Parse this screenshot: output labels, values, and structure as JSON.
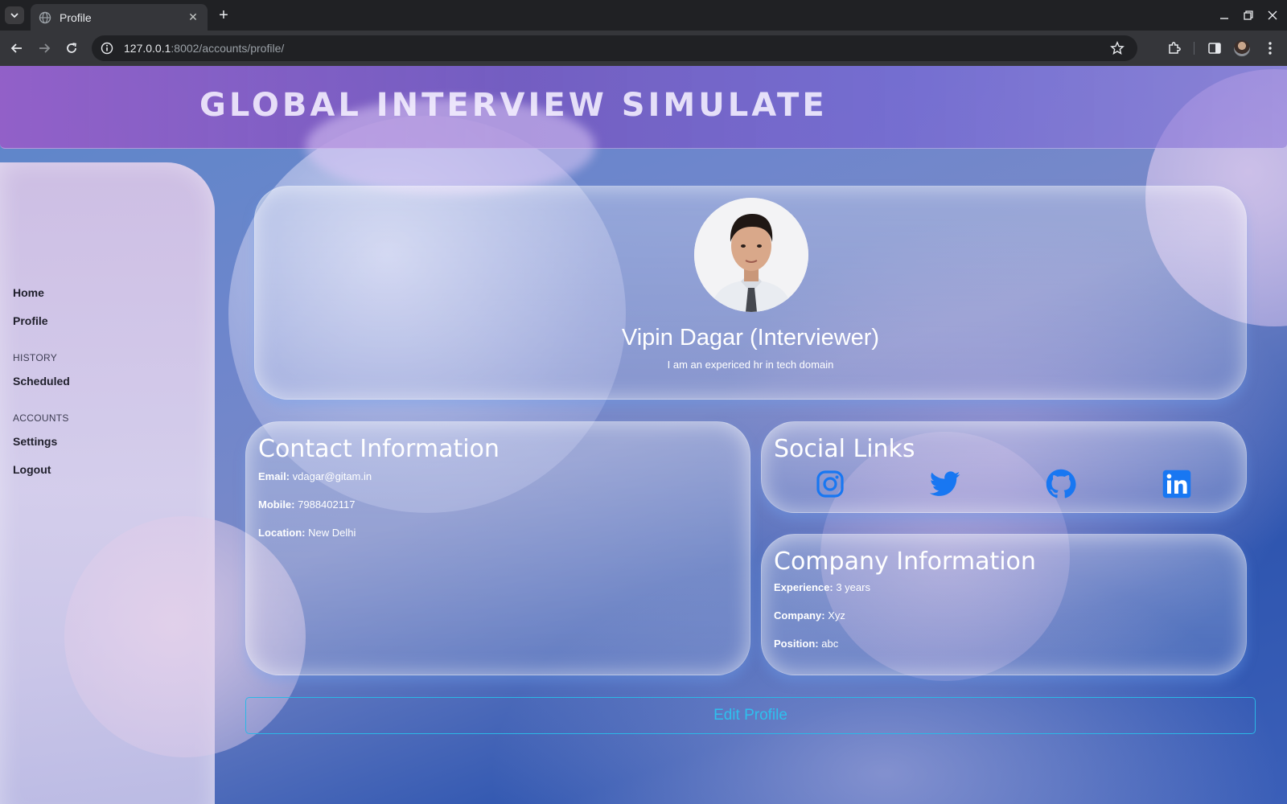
{
  "browser": {
    "tab_title": "Profile",
    "url_host": "127.0.0.1",
    "url_rest": ":8002/accounts/profile/"
  },
  "header": {
    "brand": "GLOBAL INTERVIEW SIMULATE"
  },
  "sidebar": {
    "home": "Home",
    "profile": "Profile",
    "history_heading": "HISTORY",
    "scheduled": "Scheduled",
    "accounts_heading": "ACCOUNTS",
    "settings": "Settings",
    "logout": "Logout"
  },
  "profile": {
    "name": "Vipin Dagar (Interviewer)",
    "bio": "I am an expericed hr in tech domain"
  },
  "contact": {
    "title": "Contact Information",
    "email_label": "Email:",
    "email": "vdagar@gitam.in",
    "mobile_label": "Mobile:",
    "mobile": "7988402117",
    "location_label": "Location:",
    "location": "New Delhi"
  },
  "social": {
    "title": "Social Links",
    "icons": [
      "instagram-icon",
      "twitter-icon",
      "github-icon",
      "linkedin-icon"
    ],
    "icon_color": "#1877f2"
  },
  "company": {
    "title": "Company Information",
    "experience_label": "Experience:",
    "experience": "3 years",
    "company_label": "Company:",
    "company": "Xyz",
    "position_label": "Position:",
    "position": "abc"
  },
  "actions": {
    "edit_profile": "Edit Profile"
  }
}
